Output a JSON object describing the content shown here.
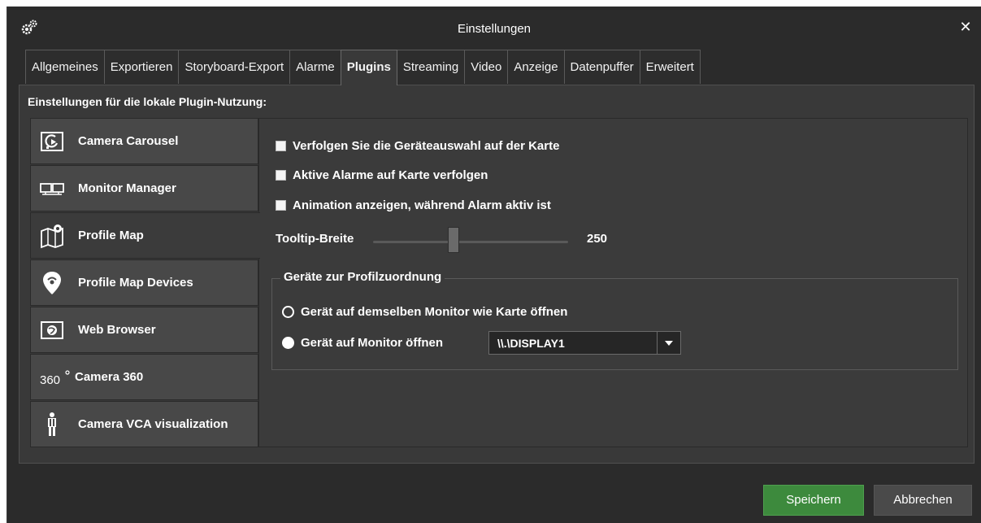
{
  "window": {
    "title": "Einstellungen",
    "close_symbol": "✕"
  },
  "tabs": [
    {
      "label": "Allgemeines",
      "active": false
    },
    {
      "label": "Exportieren",
      "active": false
    },
    {
      "label": "Storyboard-Export",
      "active": false
    },
    {
      "label": "Alarme",
      "active": false
    },
    {
      "label": "Plugins",
      "active": true
    },
    {
      "label": "Streaming",
      "active": false
    },
    {
      "label": "Video",
      "active": false
    },
    {
      "label": "Anzeige",
      "active": false
    },
    {
      "label": "Datenpuffer",
      "active": false
    },
    {
      "label": "Erweitert",
      "active": false
    }
  ],
  "panel": {
    "heading": "Einstellungen für die lokale Plugin-Nutzung:"
  },
  "sidebar": {
    "items": [
      {
        "label": "Camera Carousel",
        "icon": "carousel-icon",
        "active": false
      },
      {
        "label": "Monitor Manager",
        "icon": "monitors-icon",
        "active": false
      },
      {
        "label": "Profile Map",
        "icon": "map-icon",
        "active": true
      },
      {
        "label": "Profile Map Devices",
        "icon": "map-pin-icon",
        "active": false
      },
      {
        "label": "Web Browser",
        "icon": "globe-window-icon",
        "active": false
      },
      {
        "label": "Camera 360",
        "icon": "360-icon",
        "active": false
      },
      {
        "label": "Camera VCA visualization",
        "icon": "person-icon",
        "active": false
      }
    ]
  },
  "options": {
    "checkboxes": [
      {
        "label": "Verfolgen Sie die Geräteauswahl auf der Karte",
        "checked": false
      },
      {
        "label": "Aktive Alarme auf Karte verfolgen",
        "checked": false
      },
      {
        "label": "Animation anzeigen, während Alarm aktiv ist",
        "checked": false
      }
    ],
    "tooltip": {
      "label": "Tooltip-Breite",
      "value": "250"
    },
    "group": {
      "title": "Geräte zur Profilzuordnung",
      "radio_same": "Gerät auf demselben Monitor wie Karte öffnen",
      "radio_monitor": "Gerät auf Monitor öffnen",
      "selected": "radio_monitor",
      "monitor_value": "\\\\.\\DISPLAY1"
    }
  },
  "buttons": {
    "save": "Speichern",
    "cancel": "Abbrechen"
  },
  "colors": {
    "window_bg": "#2b2b2b",
    "panel_bg": "#393939",
    "save_accent": "#3d8a3d"
  }
}
